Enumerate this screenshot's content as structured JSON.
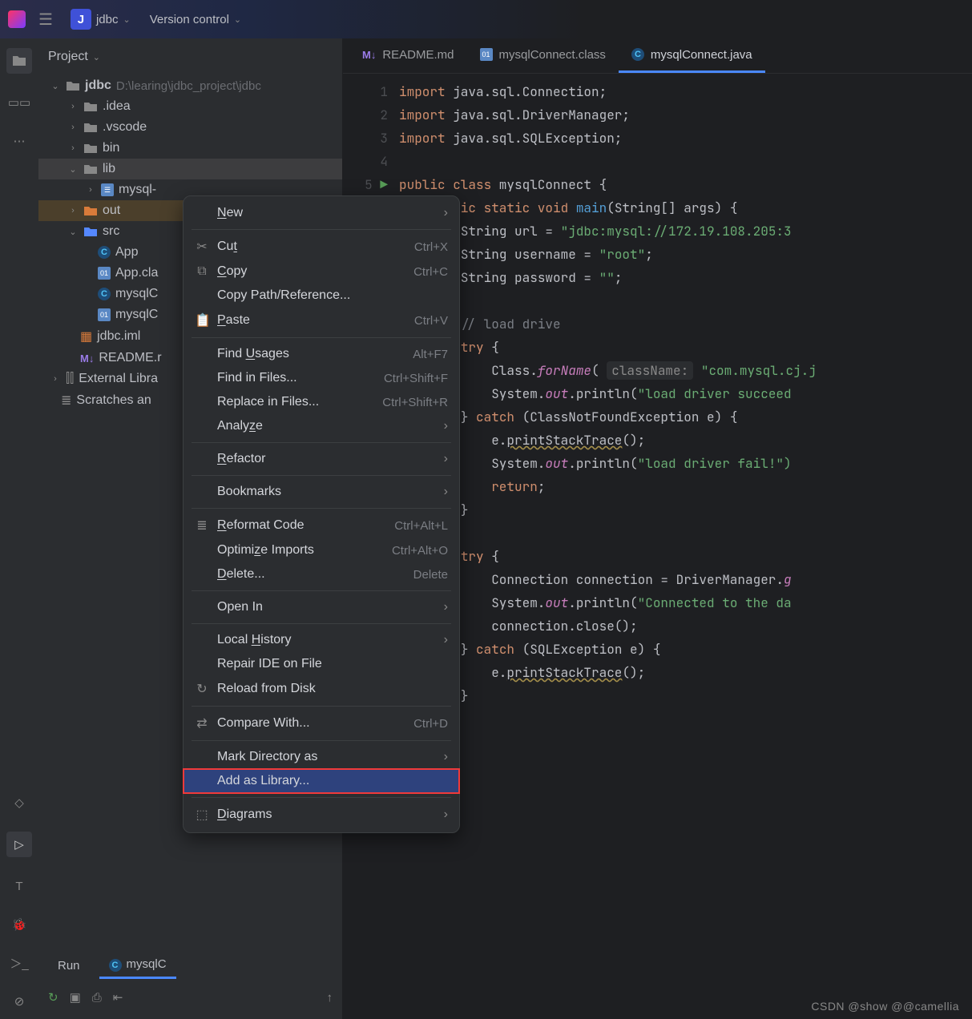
{
  "titlebar": {
    "project": "jdbc",
    "vc": "Version control"
  },
  "panel": {
    "title": "Project"
  },
  "tree": {
    "root": {
      "name": "jdbc",
      "path": "D:\\learing\\jdbc_project\\jdbc"
    },
    "idea": ".idea",
    "vscode": ".vscode",
    "bin": "bin",
    "lib": "lib",
    "mysql": "mysql-",
    "out": "out",
    "src": "src",
    "app": "App",
    "appcls": "App.cla",
    "mc1": "mysqlC",
    "mc2": "mysqlC",
    "iml": "jdbc.iml",
    "readme": "README.r",
    "ext": "External Libra",
    "scratch": "Scratches an"
  },
  "tabs": {
    "t1": "README.md",
    "t2": "mysqlConnect.class",
    "t3": "mysqlConnect.java"
  },
  "code": {
    "l1a": "import",
    "l1b": " java.sql.Connection;",
    "l2a": "import",
    "l2b": " java.sql.DriverManager;",
    "l3a": "import",
    "l3b": " java.sql.SQLException;",
    "l5a": "public class",
    "l5b": " mysqlConnect {",
    "l6a": "public static void",
    "l6b": "main",
    "l6c": "(String[] args) {",
    "l7a": "String url = ",
    "l7b": "\"jdbc:mysql://172.19.108.205:3",
    "l8a": "String username = ",
    "l8b": "\"root\"",
    "l8c": ";",
    "l9a": "String password = ",
    "l9b": "\"\"",
    "l9c": ";",
    "l11": "// load drive",
    "l12a": "try",
    "l12b": " {",
    "l13a": "Class.",
    "l13b": "forName",
    "l13c": "(",
    "l13h": "className:",
    "l13d": "\"com.mysql.cj.j",
    "l14a": "System.",
    "l14b": "out",
    "l14c": ".println(",
    "l14d": "\"load driver succeed",
    "l15a": "} ",
    "l15b": "catch",
    "l15c": " (ClassNotFoundException e) {",
    "l16a": "e.",
    "l16b": "printStackTrace",
    "l16c": "();",
    "l17a": "System.",
    "l17b": "out",
    "l17c": ".println(",
    "l17d": "\"load driver fail!\")",
    "l18a": "return",
    "l18b": ";",
    "l19": "}",
    "l21a": "try",
    "l21b": " {",
    "l22a": "Connection connection = DriverManager.",
    "l22b": "g",
    "l23a": "System.",
    "l23b": "out",
    "l23c": ".println(",
    "l23d": "\"Connected to the da",
    "l24": "connection.close();",
    "l25a": "} ",
    "l25b": "catch",
    "l25c": " (SQLException e) {",
    "l26a": "e.",
    "l26b": "printStackTrace",
    "l26c": "();",
    "l27": "}",
    "l29": "}"
  },
  "gutter": [
    "1",
    "2",
    "3",
    "4",
    "5",
    "",
    "",
    "",
    "",
    "",
    "",
    "",
    "",
    "",
    "",
    "",
    "",
    "",
    "",
    "",
    "",
    "",
    "",
    "",
    "",
    "",
    "",
    ""
  ],
  "ctx": {
    "new": "New",
    "cut": "Cut",
    "cut_sc": "Ctrl+X",
    "copy": "Copy",
    "copy_sc": "Ctrl+C",
    "copypath": "Copy Path/Reference...",
    "paste": "Paste",
    "paste_sc": "Ctrl+V",
    "findu": "Find Usages",
    "findu_sc": "Alt+F7",
    "findf": "Find in Files...",
    "findf_sc": "Ctrl+Shift+F",
    "repl": "Replace in Files...",
    "repl_sc": "Ctrl+Shift+R",
    "analyze": "Analyze",
    "refactor": "Refactor",
    "bookmarks": "Bookmarks",
    "reformat": "Reformat Code",
    "reformat_sc": "Ctrl+Alt+L",
    "opti": "Optimize Imports",
    "opti_sc": "Ctrl+Alt+O",
    "delete": "Delete...",
    "delete_sc": "Delete",
    "openin": "Open In",
    "lhist": "Local History",
    "repair": "Repair IDE on File",
    "reload": "Reload from Disk",
    "compare": "Compare With...",
    "compare_sc": "Ctrl+D",
    "markdir": "Mark Directory as",
    "addlib": "Add as Library...",
    "diagrams": "Diagrams"
  },
  "run": {
    "tab1": "Run",
    "tab2": "mysqlC"
  },
  "watermark": "CSDN @show @@camellia"
}
